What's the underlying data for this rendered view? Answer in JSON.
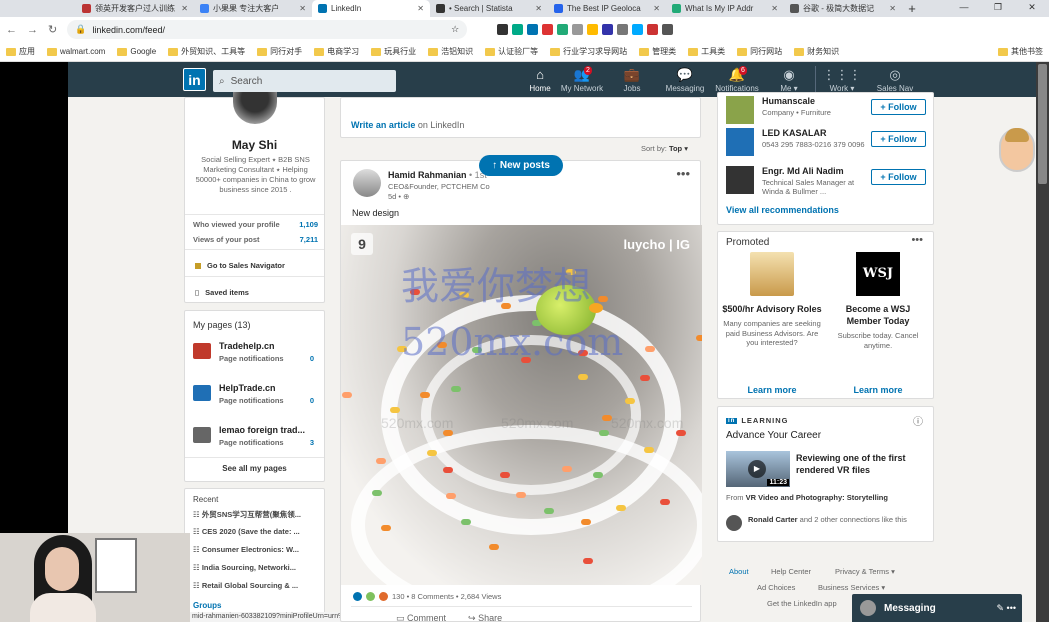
{
  "browser": {
    "tabs": [
      {
        "title": "领英开发客户过人训练",
        "color": "#b33"
      },
      {
        "title": "小果果 专注大客户",
        "color": "#3b82f6"
      },
      {
        "title": "LinkedIn",
        "color": "#0073b1",
        "active": true
      },
      {
        "title": "• Search | Statista",
        "color": "#333"
      },
      {
        "title": "The Best IP Geoloca",
        "color": "#2563eb"
      },
      {
        "title": "What Is My IP Addr",
        "color": "#2a7"
      },
      {
        "title": "谷歌 - 极简大数据记",
        "color": "#555"
      }
    ],
    "url": "linkedin.com/feed/",
    "bookmarks": [
      "应用",
      "walmart.com",
      "Google",
      "外贸知识、工具等",
      "同行对手",
      "电商学习",
      "玩具行业",
      "浩铝知识",
      "认证验厂等",
      "行业学习求导网站",
      "管理类",
      "工具类",
      "同行网站",
      "财务知识"
    ],
    "other_bookmarks": "其他书签"
  },
  "nav": {
    "search_placeholder": "Search",
    "items": [
      {
        "label": "Home",
        "icon": "home-icon",
        "badge": ""
      },
      {
        "label": "My Network",
        "icon": "network-icon",
        "badge": "2"
      },
      {
        "label": "Jobs",
        "icon": "jobs-icon",
        "badge": ""
      },
      {
        "label": "Messaging",
        "icon": "messaging-icon",
        "badge": ""
      },
      {
        "label": "Notifications",
        "icon": "bell-icon",
        "badge": "6"
      },
      {
        "label": "Me ▾",
        "icon": "me-icon",
        "badge": ""
      },
      {
        "label": "Work ▾",
        "icon": "grid-icon",
        "badge": ""
      },
      {
        "label": "Sales Nav",
        "icon": "compass-icon",
        "badge": ""
      }
    ]
  },
  "profile": {
    "name": "May Shi",
    "headline": "Social Selling Expert ⭑ B2B SNS Marketing Consultant ⭑ Helping 50000+ companies in China to grow business since 2015 .",
    "stats": [
      {
        "label": "Who viewed your profile",
        "value": "1,109"
      },
      {
        "label": "Views of your post",
        "value": "7,211"
      }
    ],
    "sales_nav": "Go to Sales Navigator",
    "saved": "Saved items"
  },
  "pages": {
    "header": "My pages (13)",
    "items": [
      {
        "name": "Tradehelp.cn",
        "sub": "Page notifications",
        "count": "0"
      },
      {
        "name": "HelpTrade.cn",
        "sub": "Page notifications",
        "count": "0"
      },
      {
        "name": "lemao foreign trad...",
        "sub": "Page notifications",
        "count": "3"
      }
    ],
    "see_all": "See all my pages"
  },
  "recent": {
    "header": "Recent",
    "items": [
      "外贸SNS学习互帮营(聚焦领...",
      "CES 2020 (Save the date: ...",
      "Consumer Electronics: W...",
      "India Sourcing, Networki...",
      "Retail Global Sourcing & ..."
    ],
    "groups": "Groups"
  },
  "status_url": "mid-rahmanien-603382109?miniProfileUrn=urn%3...",
  "feed": {
    "write_article_link": "Write an article",
    "write_article_suffix": " on LinkedIn",
    "sort_label": "Sort by:",
    "sort_value": "Top ▾",
    "new_posts": "↑ New posts",
    "post": {
      "author": "Hamid Rahmanian",
      "degree": " • 1st",
      "headline": "CEO&Founder, PCTCHEM Co",
      "time": "5d • ",
      "text": "New design",
      "image_brand": "luycho | IG",
      "image_brand_logo": "9",
      "watermark_cn": "我爱你梦想",
      "watermark_url": "520mx.com",
      "social": "130 • 8 Comments • 2,684 Views",
      "actions": [
        "Comment",
        "Share"
      ]
    }
  },
  "recs": {
    "items": [
      {
        "name": "Humanscale",
        "sub": "Company • Furniture",
        "follow": "+ Follow",
        "color": "#8aa34a"
      },
      {
        "name": "LED KASALAR",
        "sub": "0543 295 7883-0216 379 0096",
        "follow": "+ Follow",
        "color": "#1f6fb5"
      },
      {
        "name": "Engr. Md Ali Nadim",
        "sub": "Technical Sales Manager at Winda & Bullmer ...",
        "follow": "+ Follow",
        "color": "#333"
      }
    ],
    "view_all": "View all recommendations"
  },
  "promoted": {
    "header": "Promoted",
    "items": [
      {
        "title": "$500/hr Advisory Roles",
        "desc": "Many companies are seeking paid Business Advisors. Are you interested?",
        "cta": "Learn more",
        "logo": ""
      },
      {
        "title": "Become a WSJ Member Today",
        "desc": "Subscribe today. Cancel anytime.",
        "cta": "Learn more",
        "logo": "WSJ"
      }
    ]
  },
  "learning": {
    "label": "LEARNING",
    "title": "Advance Your Career",
    "video_title": "Reviewing one of the first rendered VR files",
    "duration": "11:23",
    "from_prefix": "From ",
    "from_course": "VR Video and Photography: Storytelling",
    "liked_name": "Ronald Carter",
    "liked_rest": " and 2 other connections like this"
  },
  "footer": {
    "links": [
      "About",
      "Help Center",
      "Privacy & Terms ▾",
      "Ad Choices",
      "Business Services ▾",
      "Get the LinkedIn app"
    ]
  },
  "messaging": {
    "label": "Messaging"
  }
}
